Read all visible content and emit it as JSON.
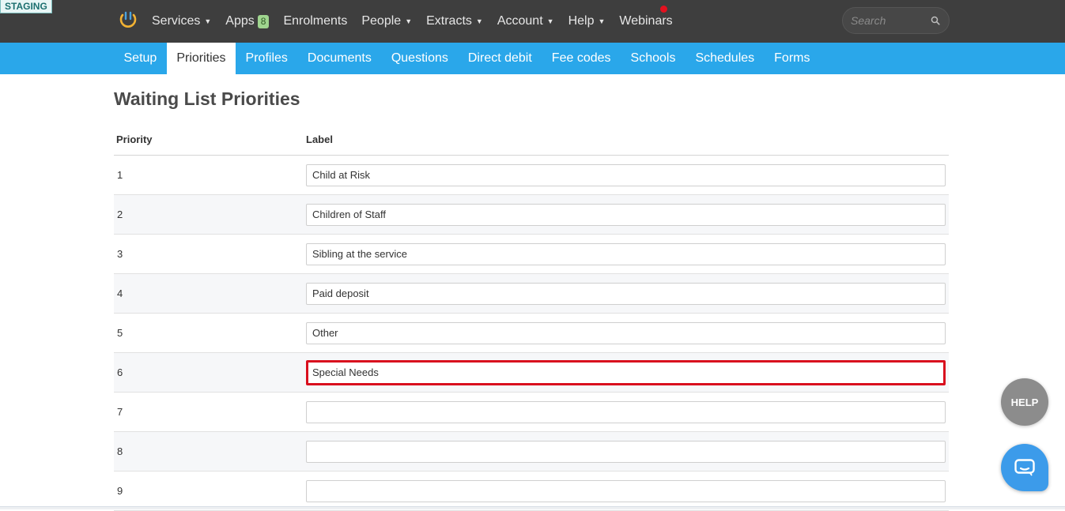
{
  "env_badge": "STAGING",
  "topnav": {
    "items": [
      {
        "label": "Services",
        "has_caret": true
      },
      {
        "label": "Apps",
        "badge": "8"
      },
      {
        "label": "Enrolments"
      },
      {
        "label": "People",
        "has_caret": true
      },
      {
        "label": "Extracts",
        "has_caret": true
      },
      {
        "label": "Account",
        "has_caret": true
      },
      {
        "label": "Help",
        "has_caret": true
      },
      {
        "label": "Webinars"
      }
    ],
    "caret": "▼",
    "notification_color": "#e3111f",
    "search": {
      "placeholder": "Search",
      "icon": "search-icon"
    }
  },
  "subnav": {
    "tabs": [
      "Setup",
      "Priorities",
      "Profiles",
      "Documents",
      "Questions",
      "Direct debit",
      "Fee codes",
      "Schools",
      "Schedules",
      "Forms"
    ],
    "active": "Priorities",
    "color": "#2aa7ea"
  },
  "main": {
    "title": "Waiting List Priorities",
    "columns": {
      "priority": "Priority",
      "label": "Label"
    },
    "rows": [
      {
        "priority": "1",
        "label": "Child at Risk"
      },
      {
        "priority": "2",
        "label": "Children of Staff"
      },
      {
        "priority": "3",
        "label": "Sibling at the service"
      },
      {
        "priority": "4",
        "label": "Paid deposit"
      },
      {
        "priority": "5",
        "label": "Other"
      },
      {
        "priority": "6",
        "label": "Special Needs",
        "focused": true
      },
      {
        "priority": "7",
        "label": ""
      },
      {
        "priority": "8",
        "label": ""
      },
      {
        "priority": "9",
        "label": ""
      }
    ]
  },
  "widgets": {
    "help_label": "HELP",
    "chat_icon": "chat-bubble-icon"
  }
}
